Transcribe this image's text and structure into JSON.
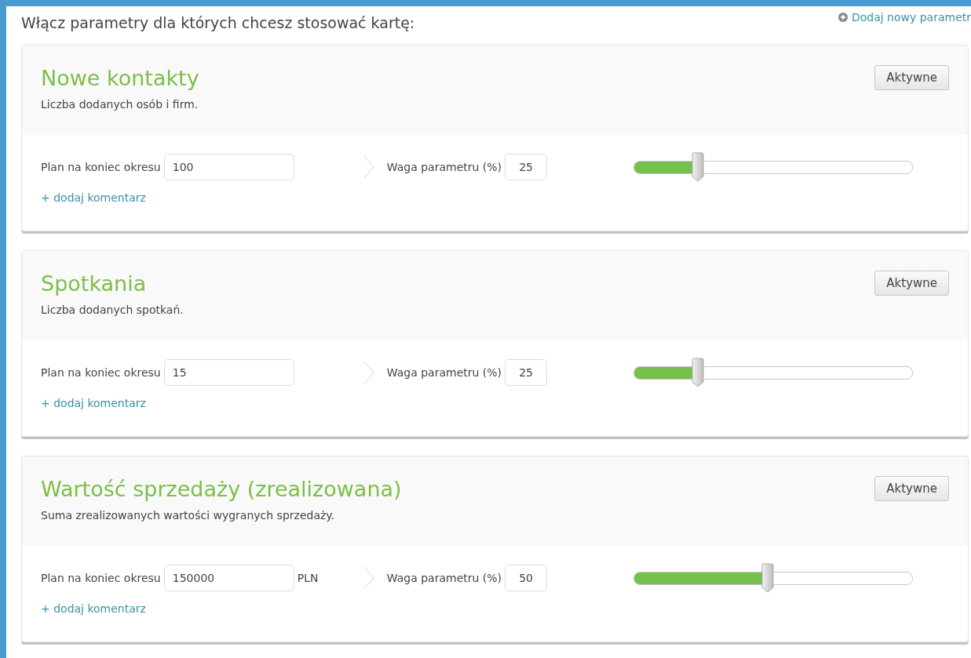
{
  "heading": "Włącz parametry dla których chcesz stosować kartę:",
  "add_link": "Dodaj nowy parametr",
  "parameters": [
    {
      "title": "Nowe kontakty",
      "description": "Liczba dodanych osób i firm.",
      "status_button": "Aktywne",
      "plan_label": "Plan na koniec okresu",
      "plan_value": "100",
      "weight_label": "Waga parametru (%)",
      "weight_value": "25",
      "level": 0.23,
      "comment_link": "+ dodaj komentarz"
    },
    {
      "title": "Spotkania",
      "description": "Liczba dodanych spotkań.",
      "status_button": "Aktywne",
      "plan_label": "Plan na koniec okresu",
      "plan_value": "15",
      "weight_label": "Waga parametru (%)",
      "weight_value": "25",
      "level": 0.23,
      "comment_link": "+ dodaj komentarz"
    },
    {
      "title": "Wartość sprzedaży (zrealizowana)",
      "description": "Suma zrealizowanych wartości wygranych sprzedaży.",
      "status_button": "Aktywne",
      "plan_label": "Plan na koniec okresu",
      "plan_value": "150000",
      "unit": "PLN",
      "weight_label": "Waga parametru (%)",
      "weight_value": "50",
      "level": 0.48,
      "comment_link": "+ dodaj komentarz"
    }
  ]
}
